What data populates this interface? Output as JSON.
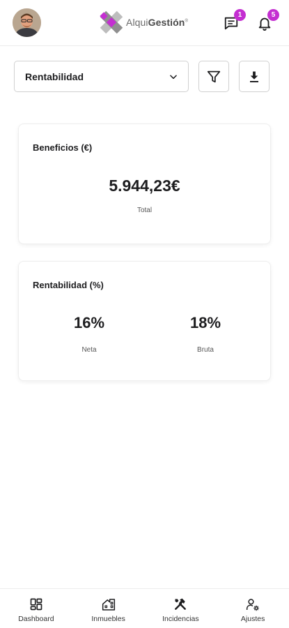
{
  "header": {
    "avatar_icon": "user-avatar",
    "logo": {
      "text_light": "Alqui",
      "text_bold": "Gestión",
      "mark": "®"
    },
    "chat_badge": "1",
    "notifications_badge": "5",
    "badge_color": "#c42fd1"
  },
  "filters": {
    "selected_view": "Rentabilidad",
    "filter_icon": "filter-icon",
    "download_icon": "download-icon"
  },
  "benefits_card": {
    "title": "Beneficios (€)",
    "value": "5.944,23€",
    "label": "Total"
  },
  "profitability_card": {
    "title": "Rentabilidad (%)",
    "net_value": "16%",
    "net_label": "Neta",
    "gross_value": "18%",
    "gross_label": "Bruta"
  },
  "bottom_nav": {
    "items": [
      {
        "label": "Dashboard",
        "icon": "dashboard-icon"
      },
      {
        "label": "Inmuebles",
        "icon": "building-icon"
      },
      {
        "label": "Incidencias",
        "icon": "tools-icon"
      },
      {
        "label": "Ajustes",
        "icon": "user-settings-icon"
      }
    ]
  }
}
